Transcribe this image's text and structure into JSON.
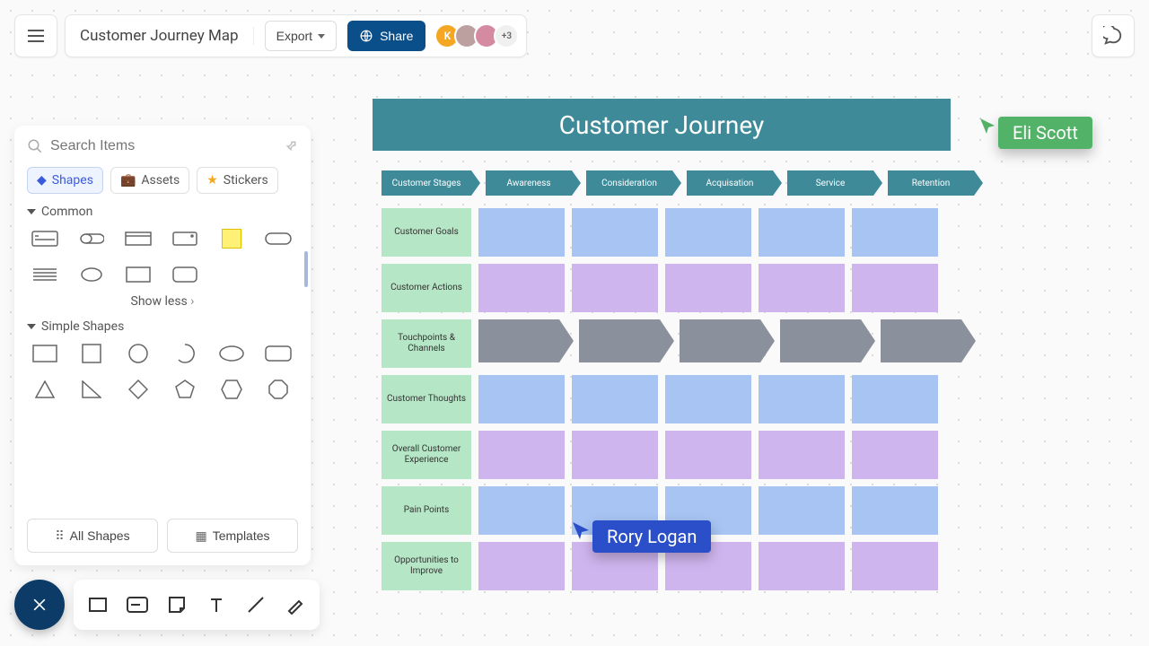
{
  "topbar": {
    "doc_title": "Customer Journey Map",
    "export_label": "Export",
    "share_label": "Share",
    "more_count": "+3"
  },
  "search": {
    "placeholder": "Search Items"
  },
  "tabs": {
    "shapes": "Shapes",
    "assets": "Assets",
    "stickers": "Stickers"
  },
  "sections": {
    "common": "Common",
    "show_less": "Show less",
    "simple": "Simple Shapes",
    "all_shapes": "All Shapes",
    "templates": "Templates"
  },
  "canvas": {
    "title": "Customer Journey",
    "stages_label": "Customer Stages",
    "stages": [
      "Awareness",
      "Consideration",
      "Acquisation",
      "Service",
      "Retention"
    ],
    "rows": [
      {
        "label": "Customer Goals",
        "color": "blue"
      },
      {
        "label": "Customer Actions",
        "color": "purple"
      },
      {
        "label": "Touchpoints & Channels",
        "color": "arrow"
      },
      {
        "label": "Customer Thoughts",
        "color": "blue"
      },
      {
        "label": "Overall Customer Experience",
        "color": "purple"
      },
      {
        "label": "Pain Points",
        "color": "blue"
      },
      {
        "label": "Opportunities to Improve",
        "color": "purple"
      }
    ]
  },
  "cursors": {
    "green": "Eli Scott",
    "blue": "Rory Logan"
  }
}
